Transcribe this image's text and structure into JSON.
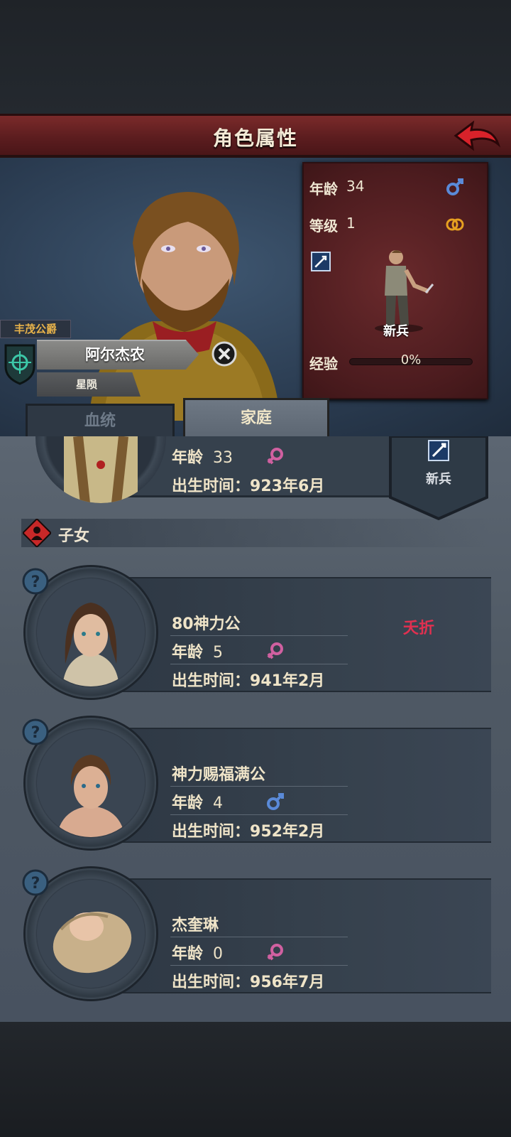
{
  "header": {
    "title": "角色属性"
  },
  "hero": {
    "title_tag": "丰茂公爵",
    "name": "阿尔杰农",
    "subtitle": "星陨"
  },
  "stats": {
    "age_label": "年龄",
    "age_value": "34",
    "level_label": "等级",
    "level_value": "1",
    "class_name": "新兵",
    "exp_label": "经验",
    "exp_value": "0%",
    "exp_fraction": 0
  },
  "tabs": [
    {
      "label": "血统",
      "active": false
    },
    {
      "label": "家庭",
      "active": true
    }
  ],
  "spouse": {
    "age_label": "年龄",
    "age_value": "33",
    "birth_label": "出生时间：",
    "birth_value": "923年6月",
    "class_name": "新兵"
  },
  "children_section": {
    "title": "子女"
  },
  "children": [
    {
      "name": "80神力公",
      "age_label": "年龄",
      "age_value": "5",
      "gender": "female",
      "birth_label": "出生时间：",
      "birth_value": "941年2月",
      "status": "夭折"
    },
    {
      "name": "神力赐福满公",
      "age_label": "年龄",
      "age_value": "4",
      "gender": "male",
      "birth_label": "出生时间：",
      "birth_value": "952年2月",
      "status": ""
    },
    {
      "name": "杰奎琳",
      "age_label": "年龄",
      "age_value": "0",
      "gender": "female",
      "birth_label": "出生时间：",
      "birth_value": "956年7月",
      "status": ""
    }
  ],
  "colors": {
    "header": "#6a2426",
    "male": "#5a8ad8",
    "female": "#d060a0",
    "gold": "#e7b24a",
    "dead": "#e03050"
  },
  "icons": [
    "back-arrow-icon",
    "male-icon",
    "ring-icon",
    "sword-icon",
    "close-icon",
    "question-icon",
    "family-icon",
    "female-icon"
  ]
}
